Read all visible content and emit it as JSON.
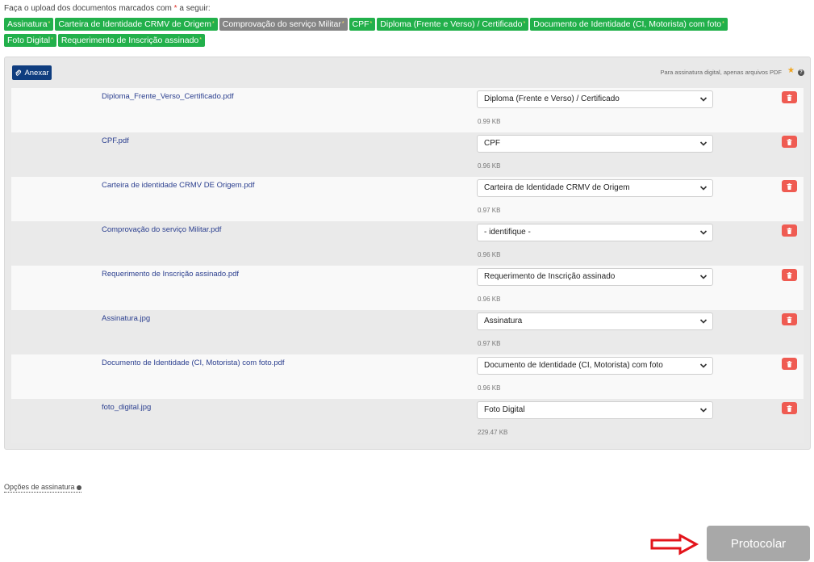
{
  "intro": {
    "prefix": "Faça o upload dos documentos marcados com",
    "star": "*",
    "suffix": "a seguir:"
  },
  "tags": [
    {
      "label": "Assinatura",
      "state": "done"
    },
    {
      "label": "Carteira de Identidade CRMV de Origem",
      "state": "done"
    },
    {
      "label": "Comprovação do serviço Militar",
      "state": "pending"
    },
    {
      "label": "CPF",
      "state": "done"
    },
    {
      "label": "Diploma (Frente e Verso) / Certificado",
      "state": "done"
    },
    {
      "label": "Documento de Identidade (CI, Motorista) com foto",
      "state": "done"
    },
    {
      "label": "Foto Digital",
      "state": "done"
    },
    {
      "label": "Requerimento de Inscrição assinado",
      "state": "done"
    }
  ],
  "panel": {
    "attach_label": "Anexar",
    "note": "Para assinatura digital, apenas arquivos PDF",
    "note_star": "★",
    "help": "?"
  },
  "files": [
    {
      "name": "Diploma_Frente_Verso_Certificado.pdf",
      "type": "Diploma (Frente e Verso) / Certificado",
      "size": "0.99 KB"
    },
    {
      "name": "CPF.pdf",
      "type": "CPF",
      "size": "0.96 KB"
    },
    {
      "name": "Carteira de identidade CRMV DE Origem.pdf",
      "type": "Carteira de Identidade CRMV de Origem",
      "size": "0.97 KB"
    },
    {
      "name": "Comprovação do serviço Militar.pdf",
      "type": "- identifique -",
      "size": "0.96 KB"
    },
    {
      "name": "Requerimento de Inscrição assinado.pdf",
      "type": "Requerimento de Inscrição assinado",
      "size": "0.96 KB"
    },
    {
      "name": "Assinatura.jpg",
      "type": "Assinatura",
      "size": "0.97 KB"
    },
    {
      "name": "Documento de Identidade (CI, Motorista) com foto.pdf",
      "type": "Documento de Identidade (CI, Motorista) com foto",
      "size": "0.96 KB"
    },
    {
      "name": "foto_digital.jpg",
      "type": "Foto Digital",
      "size": "229.47 KB"
    }
  ],
  "signature_options_label": "Opções de assinatura",
  "submit_label": "Protocolar",
  "colors": {
    "tag_done": "#22b04b",
    "tag_pending": "#858585",
    "attach_button": "#0f3d7f",
    "delete_button": "#ef5b52",
    "submit_button": "#a8a8a8",
    "arrow": "#e3141b"
  },
  "icons": {
    "attach": "paperclip-icon",
    "delete": "trash-icon",
    "select": "chevron-down-icon",
    "help": "help-circle-icon",
    "pointer": "arrow-right-icon"
  }
}
